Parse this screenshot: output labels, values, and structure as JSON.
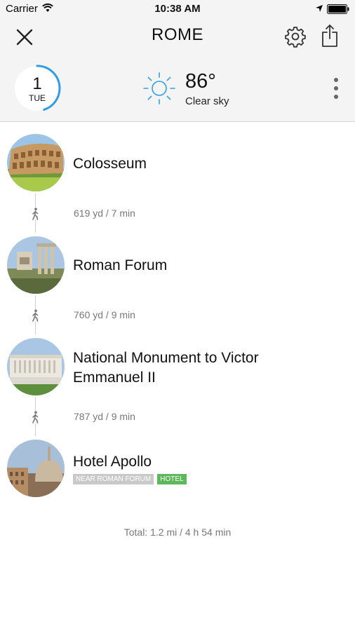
{
  "status_bar": {
    "carrier": "Carrier",
    "time": "10:38 AM"
  },
  "nav": {
    "title": "ROME"
  },
  "day": {
    "number": "1",
    "weekday": "TUE",
    "progress": 0.45
  },
  "weather": {
    "temperature": "86°",
    "condition": "Clear sky",
    "icon": "sun-icon"
  },
  "itinerary": {
    "stops": [
      {
        "name": "Colosseum"
      },
      {
        "name": "Roman Forum"
      },
      {
        "name": "National Monument to Victor Emmanuel II"
      },
      {
        "name": "Hotel Apollo",
        "tags": [
          "NEAR ROMAN FORUM",
          "HOTEL"
        ]
      }
    ],
    "legs": [
      {
        "text": "619 yd / 7 min"
      },
      {
        "text": "760 yd / 9 min"
      },
      {
        "text": "787 yd / 9 min"
      }
    ],
    "total": "Total: 1.2 mi / 4 h 54 min"
  },
  "colors": {
    "accent": "#2e9ee6",
    "hotel_tag": "#5cb85c",
    "near_tag": "#c9c9c9"
  }
}
